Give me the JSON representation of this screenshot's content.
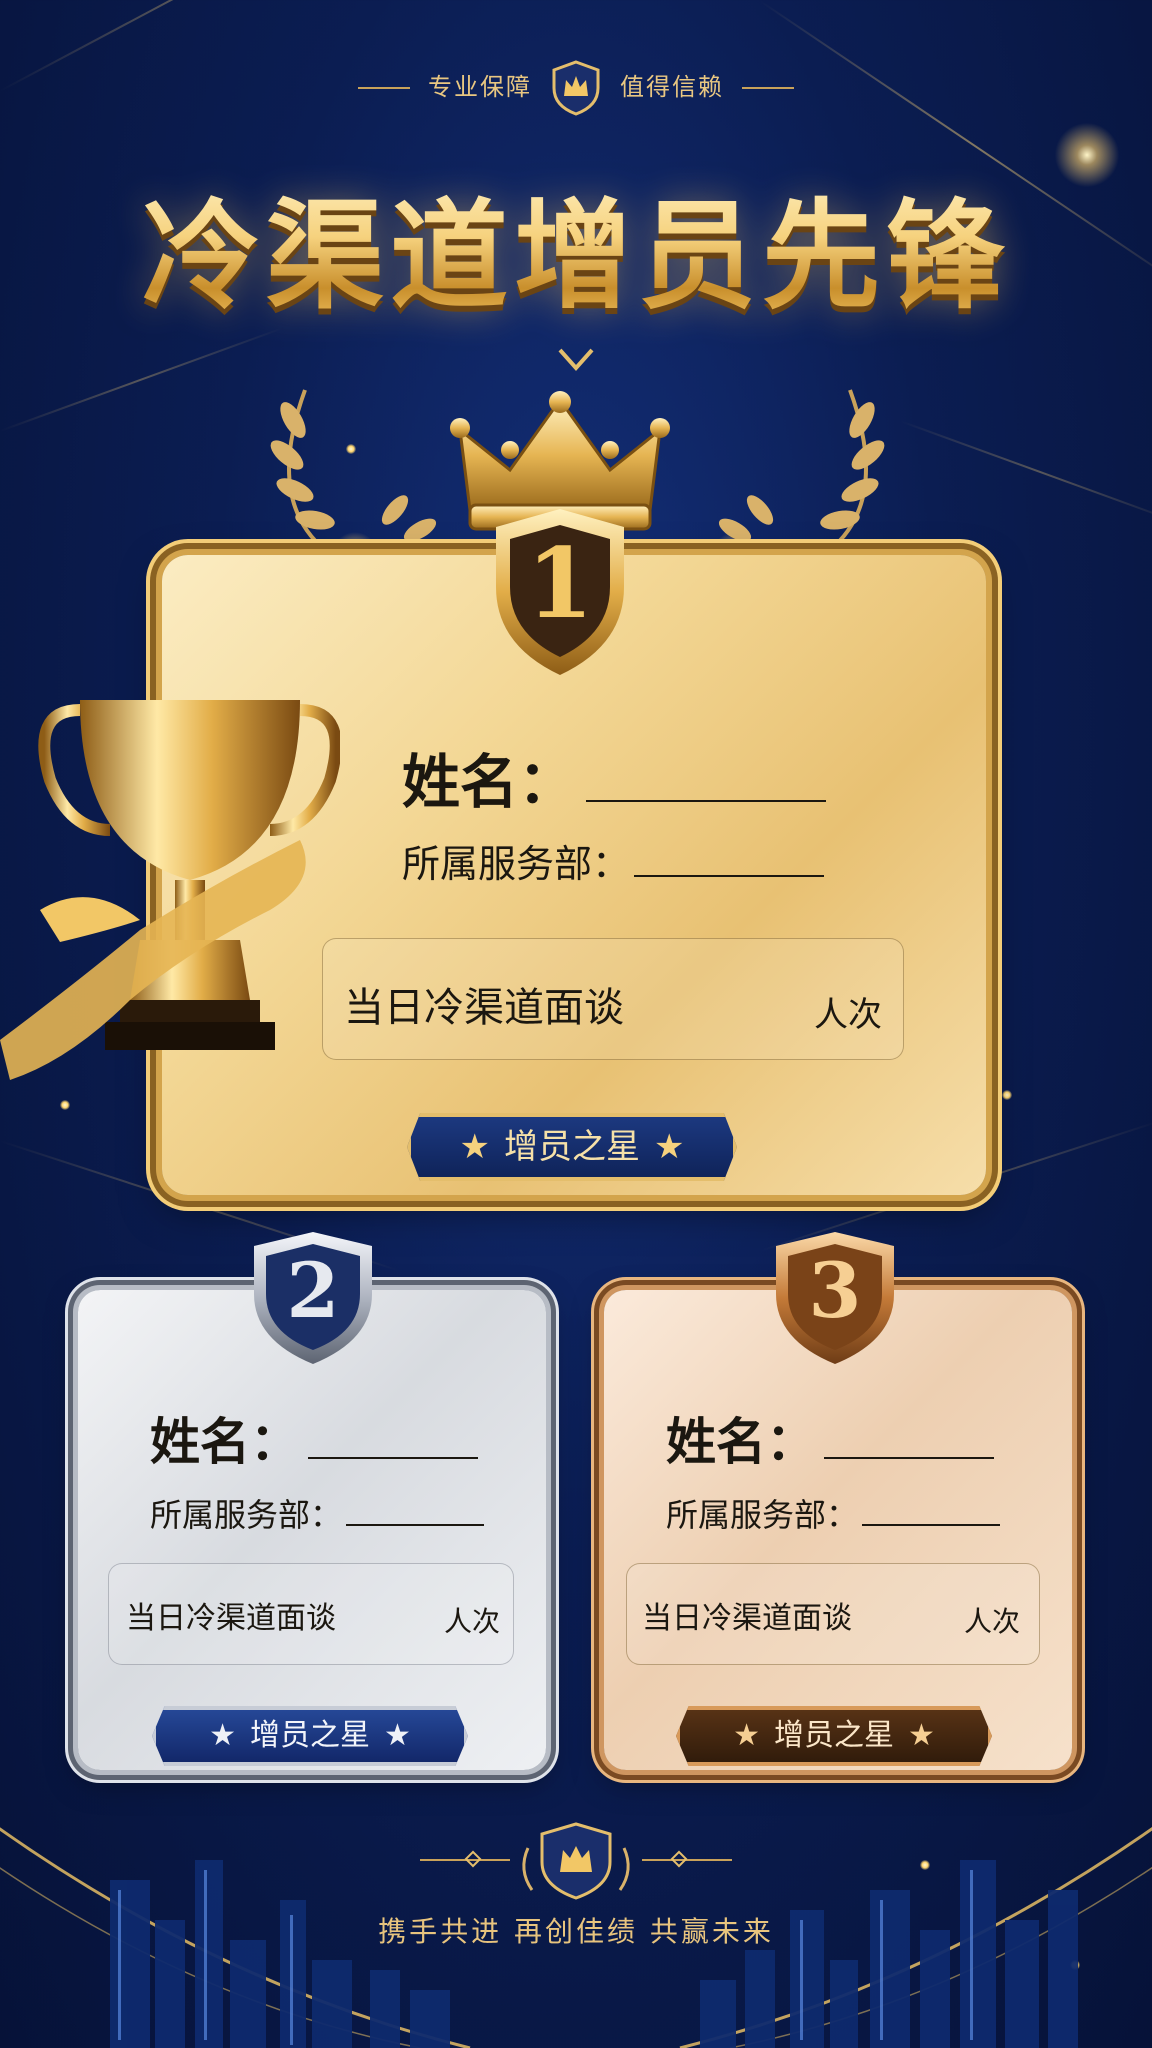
{
  "header": {
    "tagline_left": "专业保障",
    "tagline_right": "值得信赖",
    "title": "冷渠道增员先锋"
  },
  "cards": {
    "gold": {
      "rank": "1",
      "name_label": "姓名：",
      "dept_label": "所属服务部：",
      "stat_label": "当日冷渠道面谈",
      "stat_unit": "人次",
      "banner": "增员之星"
    },
    "silver": {
      "rank": "2",
      "name_label": "姓名：",
      "dept_label": "所属服务部：",
      "stat_label": "当日冷渠道面谈",
      "stat_unit": "人次",
      "banner": "增员之星"
    },
    "bronze": {
      "rank": "3",
      "name_label": "姓名：",
      "dept_label": "所属服务部：",
      "stat_label": "当日冷渠道面谈",
      "stat_unit": "人次",
      "banner": "增员之星"
    }
  },
  "footer": {
    "slogan": "携手共进  再创佳绩  共赢未来"
  },
  "icons": [
    "crown-shield-icon",
    "crown-icon",
    "trophy-icon",
    "laurel-icon",
    "star-icon",
    "city-skyline"
  ],
  "colors": {
    "background": "#0b1d52",
    "gold": "#f3d795",
    "silver": "#d8dbe0",
    "bronze": "#edcfb1",
    "banner_navy": "#142a66"
  }
}
